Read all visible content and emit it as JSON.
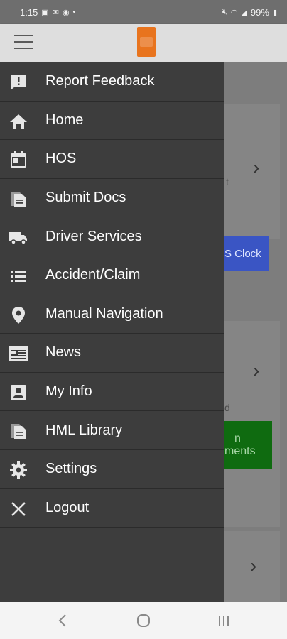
{
  "status_bar": {
    "time": "1:15",
    "battery": "99%"
  },
  "drawer": {
    "items": [
      {
        "label": "Report Feedback",
        "icon": "feedback-icon"
      },
      {
        "label": "Home",
        "icon": "home-icon"
      },
      {
        "label": "HOS",
        "icon": "calendar-icon"
      },
      {
        "label": "Submit Docs",
        "icon": "documents-icon"
      },
      {
        "label": "Driver Services",
        "icon": "truck-icon"
      },
      {
        "label": "Accident/Claim",
        "icon": "list-icon"
      },
      {
        "label": "Manual Navigation",
        "icon": "location-pin-icon"
      },
      {
        "label": "News",
        "icon": "news-icon"
      },
      {
        "label": "My Info",
        "icon": "account-box-icon"
      },
      {
        "label": "HML Library",
        "icon": "library-icon"
      },
      {
        "label": "Settings",
        "icon": "gear-icon"
      },
      {
        "label": "Logout",
        "icon": "close-icon"
      }
    ]
  },
  "background": {
    "hos_clock_button": "S Clock",
    "green_button_line1": "n",
    "green_button_line2": "ments",
    "partial_text_1": "t",
    "partial_text_2": "d",
    "colors": {
      "blue_button": "#3a55c4",
      "green_button": "#0f6b10"
    }
  }
}
